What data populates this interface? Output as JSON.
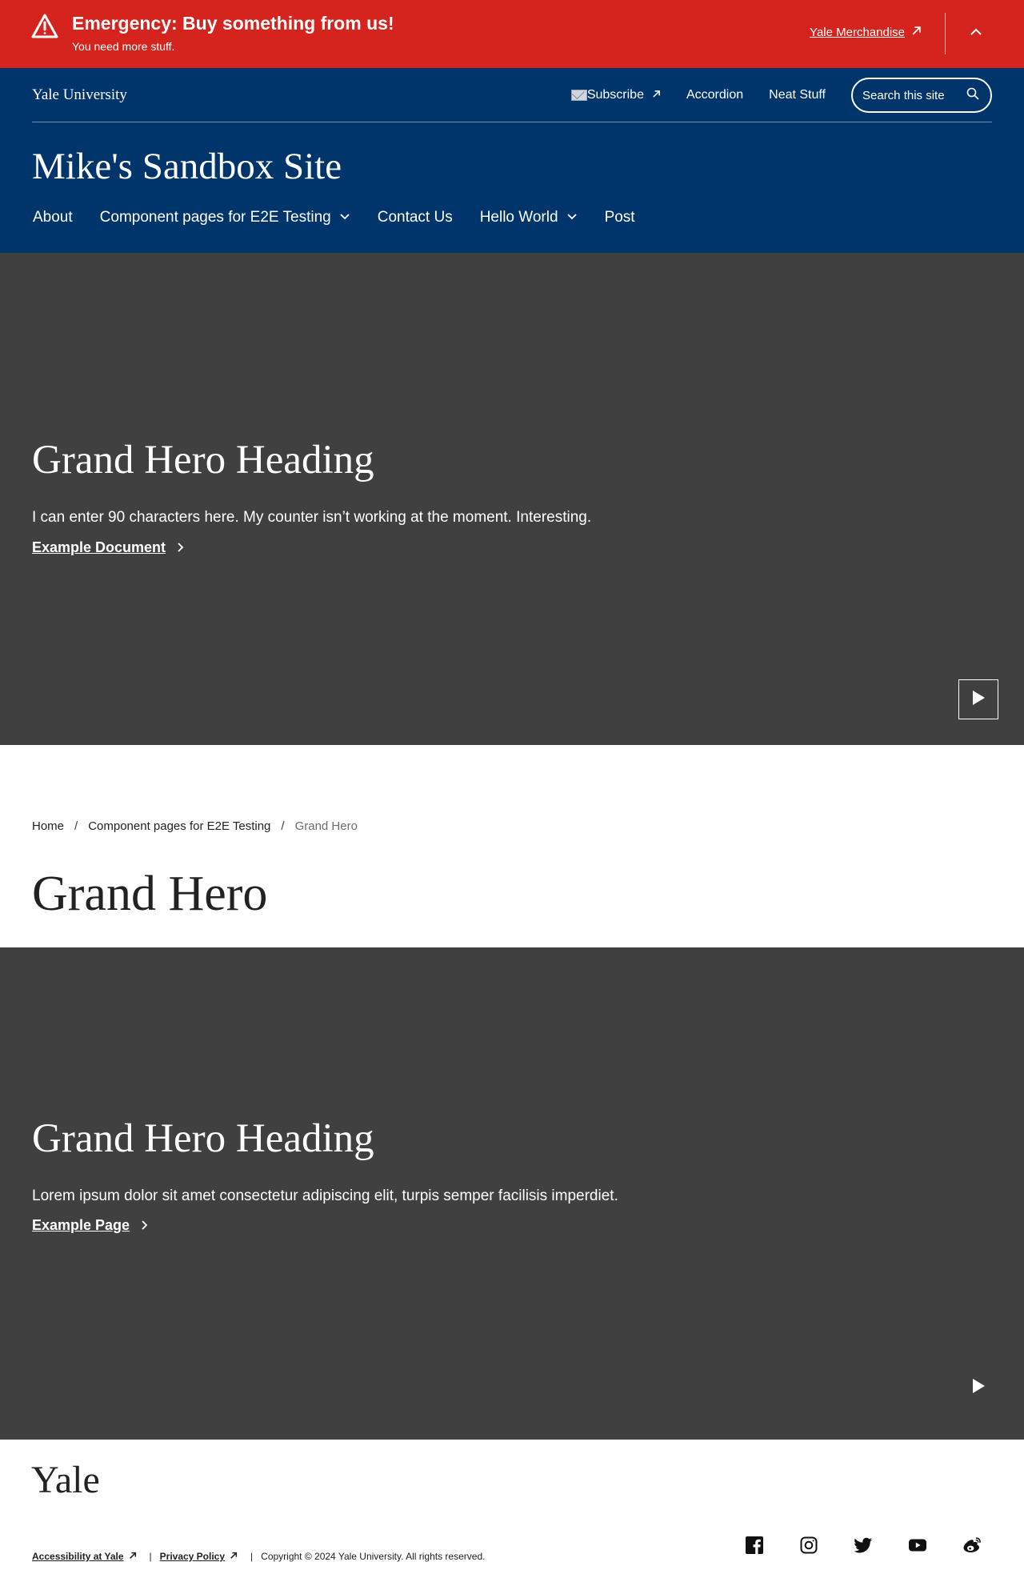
{
  "colors": {
    "alert_bg": "#d5241e",
    "header_bg": "#00356b",
    "hero_bg": "#404040",
    "text_dark": "#222222",
    "breadcrumb_current": "#6d6d6d"
  },
  "alert": {
    "icon": "warning-triangle-icon",
    "title": "Emergency: Buy something from us!",
    "subtitle": "You need more stuff.",
    "link_label": "Yale Merchandise",
    "collapse_icon": "chevron-up-icon"
  },
  "header": {
    "university": "Yale University",
    "utility": {
      "subscribe": "Subscribe",
      "subscribe_icon": "envelope-icon",
      "accordion": "Accordion",
      "neat_stuff": "Neat Stuff",
      "search_label": "Search this site",
      "search_icon": "search-icon"
    },
    "site_title": "Mike's Sandbox Site",
    "nav": [
      {
        "label": "About",
        "has_dropdown": false
      },
      {
        "label": "Component pages for E2E Testing",
        "has_dropdown": true
      },
      {
        "label": "Contact Us",
        "has_dropdown": false
      },
      {
        "label": "Hello World",
        "has_dropdown": true
      },
      {
        "label": "Post",
        "has_dropdown": false
      }
    ]
  },
  "hero1": {
    "heading": "Grand Hero Heading",
    "text": "I can enter 90 characters here. My counter isn’t working at the moment. Interesting.",
    "link_label": "Example Document",
    "play_icon": "play-icon"
  },
  "breadcrumb": {
    "home": "Home",
    "parent": "Component pages for E2E Testing",
    "separator": "/",
    "current": "Grand Hero"
  },
  "page_title": "Grand Hero",
  "hero2": {
    "heading": "Grand Hero Heading",
    "text": "Lorem ipsum dolor sit amet consectetur adipiscing elit, turpis semper facilisis imperdiet.",
    "link_label": "Example Page",
    "play_icon": "play-icon"
  },
  "footer": {
    "logo": "Yale",
    "accessibility": "Accessibility at Yale",
    "privacy": "Privacy Policy",
    "pipe": "|",
    "copyright": "Copyright © 2024 Yale University. All rights reserved.",
    "social": [
      "facebook-icon",
      "instagram-icon",
      "twitter-icon",
      "youtube-icon",
      "weibo-icon"
    ]
  }
}
